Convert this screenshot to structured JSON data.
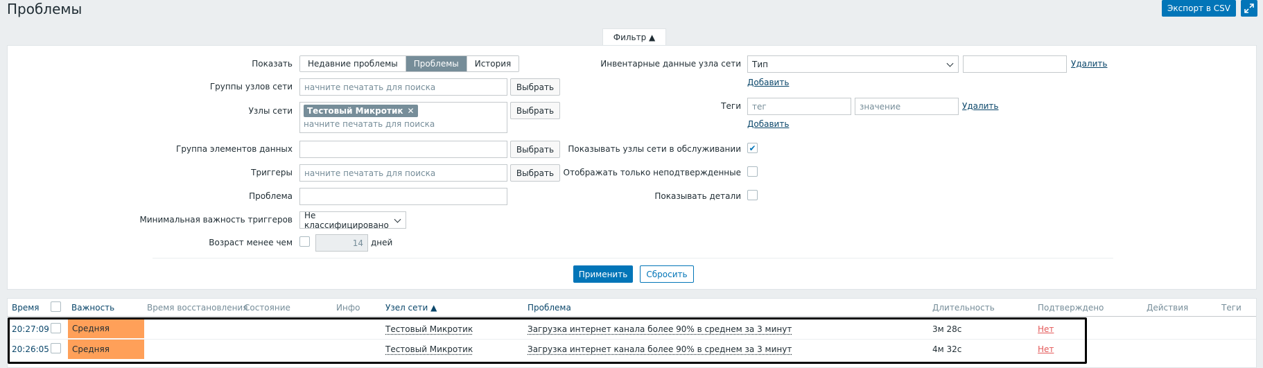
{
  "header": {
    "title": "Проблемы",
    "export_label": "Экспорт в CSV",
    "fullscreen_icon": "expand-icon"
  },
  "filter": {
    "tab_label": "Фильтр ▲",
    "show": {
      "label": "Показать",
      "options": [
        "Недавние проблемы",
        "Проблемы",
        "История"
      ],
      "selected": "Проблемы"
    },
    "host_groups": {
      "label": "Группы узлов сети",
      "placeholder": "начните печатать для поиска",
      "select_label": "Выбрать"
    },
    "hosts": {
      "label": "Узлы сети",
      "chip": "Тестовый Микротик",
      "placeholder": "начните печатать для поиска",
      "select_label": "Выбрать"
    },
    "item_group": {
      "label": "Группа элементов данных",
      "value": "",
      "select_label": "Выбрать"
    },
    "triggers": {
      "label": "Триггеры",
      "placeholder": "начните печатать для поиска",
      "select_label": "Выбрать"
    },
    "problem": {
      "label": "Проблема",
      "value": ""
    },
    "min_severity": {
      "label": "Минимальная важность триггеров",
      "value": "Не классифицировано"
    },
    "age": {
      "label": "Возраст менее чем",
      "checked": false,
      "value": "14",
      "unit": "дней"
    },
    "inventory": {
      "label": "Инвентарные данные узла сети",
      "field": "Тип",
      "value": "",
      "remove_label": "Удалить",
      "add_label": "Добавить"
    },
    "tags": {
      "label": "Теги",
      "tag_placeholder": "тег",
      "value_placeholder": "значение",
      "remove_label": "Удалить",
      "add_label": "Добавить"
    },
    "show_maintenance": {
      "label": "Показывать узлы сети в обслуживании",
      "checked": true
    },
    "show_unacknowledged": {
      "label": "Отображать только неподтвержденные",
      "checked": false
    },
    "show_details": {
      "label": "Показывать детали",
      "checked": false
    },
    "apply_label": "Применить",
    "reset_label": "Сбросить"
  },
  "table": {
    "columns": {
      "time": "Время",
      "severity": "Важность",
      "recovery_time": "Время восстановления",
      "status": "Состояние",
      "info": "Инфо",
      "host": "Узел сети ▲",
      "problem": "Проблема",
      "duration": "Длительность",
      "ack": "Подтверждено",
      "actions": "Действия",
      "tags": "Теги"
    },
    "rows": [
      {
        "time": "20:27:09",
        "severity": "Средняя",
        "host": "Тестовый Микротик",
        "problem": "Загрузка интернет канала более 90% в среднем за 3 минут",
        "duration": "3м 28с",
        "ack": "Нет"
      },
      {
        "time": "20:26:05",
        "severity": "Средняя",
        "host": "Тестовый Микротик",
        "problem": "Загрузка интернет канала более 90% в среднем за 3 минут",
        "duration": "4м 32с",
        "ack": "Нет"
      }
    ]
  },
  "colors": {
    "accent": "#0275b8",
    "severity_average": "#ffa059",
    "ack_no": "#e45959"
  }
}
